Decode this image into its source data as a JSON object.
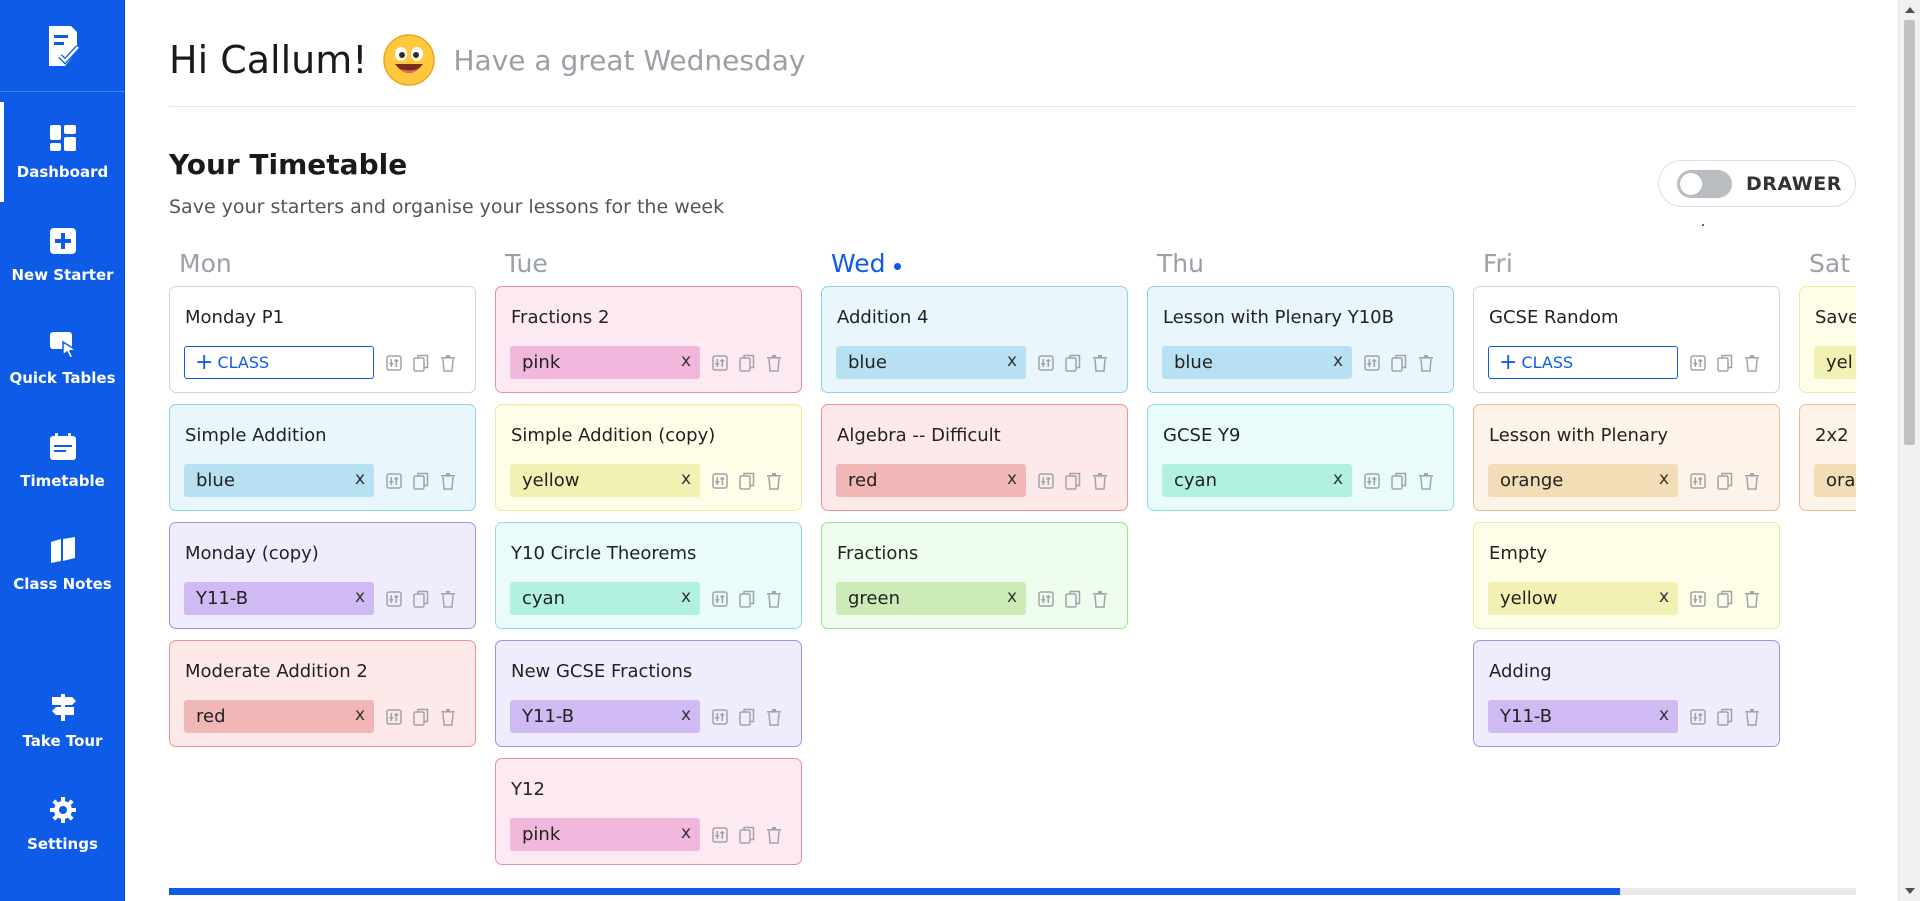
{
  "sidebar": {
    "items": [
      {
        "label": "Dashboard",
        "icon": "dashboard-icon",
        "active": true
      },
      {
        "label": "New Starter",
        "icon": "plus-icon"
      },
      {
        "label": "Quick Tables",
        "icon": "quick-tables-icon"
      },
      {
        "label": "Timetable",
        "icon": "calendar-icon"
      },
      {
        "label": "Class Notes",
        "icon": "notes-icon"
      },
      {
        "label": "Take Tour",
        "icon": "signpost-icon"
      },
      {
        "label": "Settings",
        "icon": "gear-icon"
      }
    ]
  },
  "header": {
    "greeting": "Hi Callum!",
    "subtitle": "Have a great Wednesday"
  },
  "timetable": {
    "title": "Your Timetable",
    "subtitle": "Save your starters and organise your lessons for the week",
    "drawer_label": "DRAWER",
    "drawer_on": false,
    "add_class_label": "CLASS",
    "chip_remove": "x",
    "scroll_progress": 0.86,
    "days": [
      {
        "name": "Mon",
        "current": false,
        "lessons": [
          {
            "title": "Monday P1",
            "class": null,
            "color": null
          },
          {
            "title": "Simple Addition",
            "class": "blue",
            "color": "blue"
          },
          {
            "title": "Monday (copy)",
            "class": "Y11-B",
            "color": "purple"
          },
          {
            "title": "Moderate Addition 2",
            "class": "red",
            "color": "red"
          }
        ]
      },
      {
        "name": "Tue",
        "current": false,
        "lessons": [
          {
            "title": "Fractions 2",
            "class": "pink",
            "color": "pink"
          },
          {
            "title": "Simple Addition (copy)",
            "class": "yellow",
            "color": "yellow"
          },
          {
            "title": "Y10 Circle Theorems",
            "class": "cyan",
            "color": "cyan"
          },
          {
            "title": "New GCSE Fractions",
            "class": "Y11-B",
            "color": "purple"
          },
          {
            "title": "Y12",
            "class": "pink",
            "color": "pink"
          }
        ]
      },
      {
        "name": "Wed",
        "current": true,
        "lessons": [
          {
            "title": "Addition 4",
            "class": "blue",
            "color": "blue"
          },
          {
            "title": "Algebra -- Difficult",
            "class": "red",
            "color": "red"
          },
          {
            "title": "Fractions",
            "class": "green",
            "color": "green"
          }
        ]
      },
      {
        "name": "Thu",
        "current": false,
        "lessons": [
          {
            "title": "Lesson with Plenary Y10B",
            "class": "blue",
            "color": "blue"
          },
          {
            "title": "GCSE Y9",
            "class": "cyan",
            "color": "cyan"
          }
        ]
      },
      {
        "name": "Fri",
        "current": false,
        "lessons": [
          {
            "title": "GCSE Random",
            "class": null,
            "color": null
          },
          {
            "title": "Lesson with Plenary",
            "class": "orange",
            "color": "orange"
          },
          {
            "title": "Empty",
            "class": "yellow",
            "color": "yellow"
          },
          {
            "title": "Adding",
            "class": "Y11-B",
            "color": "purple"
          }
        ]
      },
      {
        "name": "Sat",
        "current": false,
        "lessons": [
          {
            "title": "Save",
            "class": "yel",
            "color": "yellow"
          },
          {
            "title": "2x2",
            "class": "ora",
            "color": "orange"
          }
        ]
      }
    ]
  },
  "colors": {
    "accent": "#0d5be6",
    "themes": {
      "none": {
        "bg": "#ffffff",
        "border": "#cfd3d8",
        "chip": "#ffffff"
      },
      "blue": {
        "bg": "#e9f6fc",
        "border": "#8fd0ea",
        "chip": "#b7e0f2"
      },
      "pink": {
        "bg": "#fde9f1",
        "border": "#e88bb5",
        "chip": "#f2b7dd"
      },
      "yellow": {
        "bg": "#fefde8",
        "border": "#ecea9c",
        "chip": "#f2f1b4"
      },
      "cyan": {
        "bg": "#e9fbfb",
        "border": "#8fdfe0",
        "chip": "#b2f1e2"
      },
      "purple": {
        "bg": "#efedfd",
        "border": "#a391e8",
        "chip": "#cfbaf4"
      },
      "red": {
        "bg": "#fde9e9",
        "border": "#ef9191",
        "chip": "#f1b7b7"
      },
      "green": {
        "bg": "#effdee",
        "border": "#9ae08f",
        "chip": "#cdebb7"
      },
      "orange": {
        "bg": "#fef3e9",
        "border": "#f0b98d",
        "chip": "#f2ddb7"
      }
    }
  }
}
